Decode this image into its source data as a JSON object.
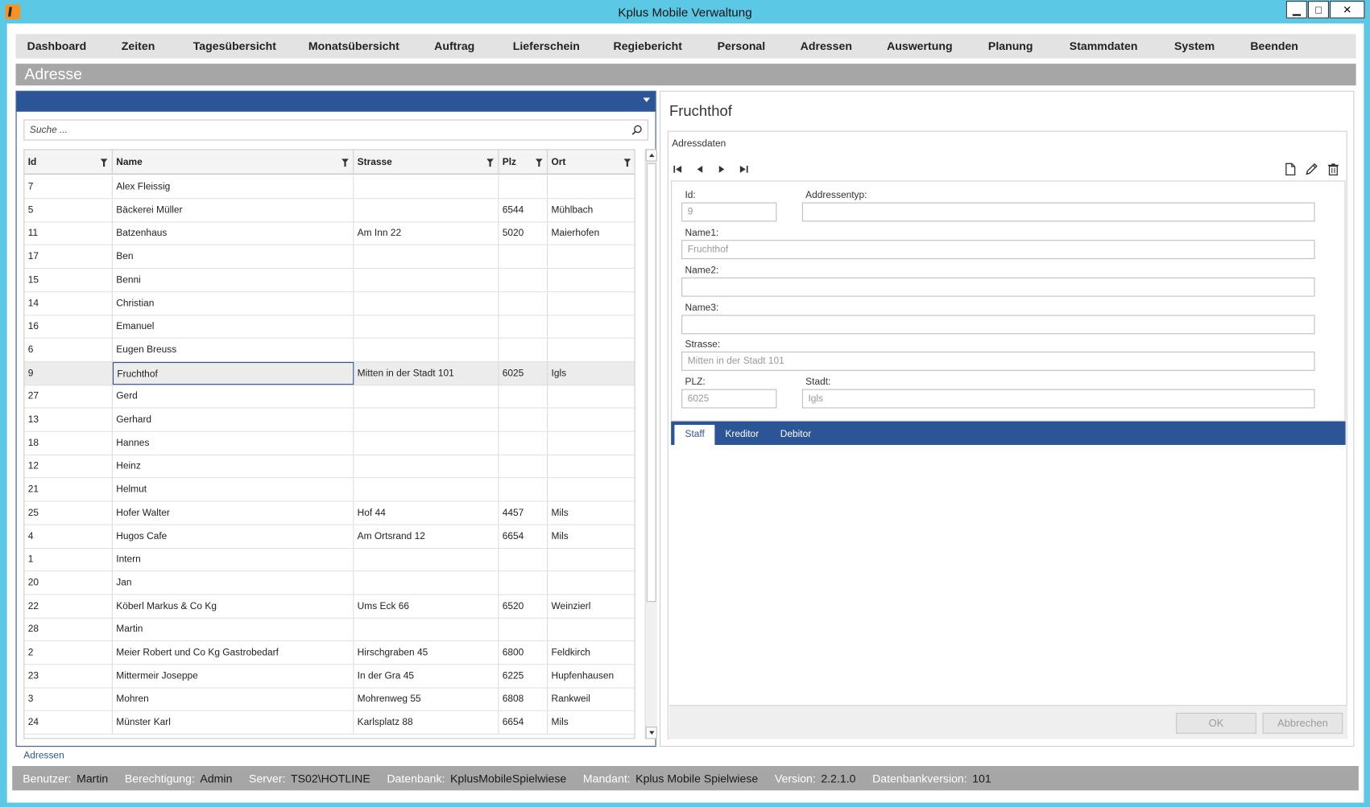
{
  "window": {
    "title": "Kplus Mobile Verwaltung",
    "buttons": [
      "▁",
      "□",
      "✕"
    ]
  },
  "menu": [
    "Dashboard",
    "Zeiten",
    "Tagesübersicht",
    "Monatsübersicht",
    "Auftrag",
    "Lieferschein",
    "Regiebericht",
    "Personal",
    "Adressen",
    "Auswertung",
    "Planung",
    "Stammdaten",
    "System",
    "Beenden"
  ],
  "page_title": "Adresse",
  "list": {
    "search_placeholder": "Suche ...",
    "columns": [
      "Id",
      "Name",
      "Strasse",
      "Plz",
      "Ort"
    ],
    "rows": [
      [
        "7",
        "Alex Fleissig",
        "",
        "",
        ""
      ],
      [
        "5",
        "Bäckerei Müller",
        "",
        "6544",
        "Mühlbach"
      ],
      [
        "11",
        "Batzenhaus",
        "Am Inn 22",
        "5020",
        "Maierhofen"
      ],
      [
        "17",
        "Ben",
        "",
        "",
        ""
      ],
      [
        "15",
        "Benni",
        "",
        "",
        ""
      ],
      [
        "14",
        "Christian",
        "",
        "",
        ""
      ],
      [
        "16",
        "Emanuel",
        "",
        "",
        ""
      ],
      [
        "6",
        "Eugen Breuss",
        "",
        "",
        ""
      ],
      [
        "9",
        "Fruchthof",
        "Mitten in der Stadt 101",
        "6025",
        "Igls"
      ],
      [
        "27",
        "Gerd",
        "",
        "",
        ""
      ],
      [
        "13",
        "Gerhard",
        "",
        "",
        ""
      ],
      [
        "18",
        "Hannes",
        "",
        "",
        ""
      ],
      [
        "12",
        "Heinz",
        "",
        "",
        ""
      ],
      [
        "21",
        "Helmut",
        "",
        "",
        ""
      ],
      [
        "25",
        "Hofer Walter",
        "Hof 44",
        "4457",
        "Mils"
      ],
      [
        "4",
        "Hugos Cafe",
        "Am Ortsrand 12",
        "6654",
        "Mils"
      ],
      [
        "1",
        "Intern",
        "",
        "",
        ""
      ],
      [
        "20",
        "Jan",
        "",
        "",
        ""
      ],
      [
        "22",
        "Köberl Markus & Co Kg",
        "Ums Eck 66",
        "6520",
        "Weinzierl"
      ],
      [
        "28",
        "Martin",
        "",
        "",
        ""
      ],
      [
        "2",
        "Meier Robert und Co Kg Gastrobedarf",
        "Hirschgraben 45",
        "6800",
        "Feldkirch"
      ],
      [
        "23",
        "Mittermeir Joseppe",
        "In der Gra 45",
        "6225",
        "Hupfenhausen"
      ],
      [
        "3",
        "Mohren",
        "Mohrenweg 55",
        "6808",
        "Rankweil"
      ],
      [
        "24",
        "Münster Karl",
        "Karlsplatz 88",
        "6654",
        "Mils"
      ]
    ],
    "selected_index": 8
  },
  "detail": {
    "title": "Fruchthof",
    "section_label": "Adressdaten",
    "nav_icons": [
      "first-record-icon",
      "previous-record-icon",
      "next-record-icon",
      "last-record-icon"
    ],
    "tool_icons": [
      "new-document-icon",
      "edit-pencil-icon",
      "delete-trash-icon"
    ],
    "fields": {
      "id_label": "Id:",
      "id_value": "9",
      "type_label": "Addressentyp:",
      "type_value": "",
      "name1_label": "Name1:",
      "name1_value": "Fruchthof",
      "name2_label": "Name2:",
      "name2_value": "",
      "name3_label": "Name3:",
      "name3_value": "",
      "strasse_label": "Strasse:",
      "strasse_value": "Mitten in der Stadt 101",
      "plz_label": "PLZ:",
      "plz_value": "6025",
      "stadt_label": "Stadt:",
      "stadt_value": "Igls"
    },
    "tabs": [
      "Staff",
      "Kreditor",
      "Debitor"
    ],
    "active_tab": "Staff",
    "ok_label": "OK",
    "cancel_label": "Abbrechen"
  },
  "breadcrumb": "Adressen",
  "status": {
    "user_label": "Benutzer:",
    "user": "Martin",
    "role_label": "Berechtigung:",
    "role": "Admin",
    "server_label": "Server:",
    "server": "TS02\\HOTLINE",
    "db_label": "Datenbank:",
    "db": "KplusMobileSpielwiese",
    "tenant_label": "Mandant:",
    "tenant": "Kplus Mobile Spielwiese",
    "version_label": "Version:",
    "version": "2.2.1.0",
    "dbversion_label": "Datenbankversion:",
    "dbversion": "101"
  },
  "colors": {
    "accent": "#2c5598",
    "titlebar": "#5bc8e6",
    "pagebar": "#a6a6a6"
  }
}
